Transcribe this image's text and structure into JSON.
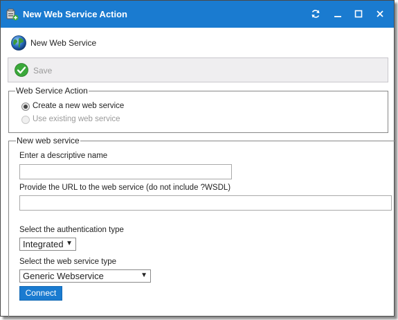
{
  "window": {
    "title": "New Web Service Action",
    "controls": {
      "refresh": "refresh-icon",
      "minimize": "minimize-icon",
      "maximize": "maximize-icon",
      "close": "close-icon"
    }
  },
  "subheader": {
    "label": "New Web Service",
    "icon": "globe-icon"
  },
  "toolbar": {
    "save_label": "Save",
    "save_icon": "checkmark-icon"
  },
  "action_group": {
    "legend": "Web Service Action",
    "options": [
      {
        "label": "Create a new web service",
        "selected": true,
        "enabled": true
      },
      {
        "label": "Use existing web service",
        "selected": false,
        "enabled": false
      }
    ]
  },
  "new_ws": {
    "legend": "New web service",
    "name_label": "Enter a descriptive name",
    "name_value": "",
    "url_label": "Provide the URL to the web service (do not include ?WSDL)",
    "url_value": "",
    "auth_label": "Select the authentication type",
    "auth_value": "Integrated",
    "type_label": "Select the web service type",
    "type_value": "Generic Webservice",
    "connect_label": "Connect"
  },
  "colors": {
    "accent": "#1a7bd0",
    "toolbar_bg": "#efeef0"
  }
}
